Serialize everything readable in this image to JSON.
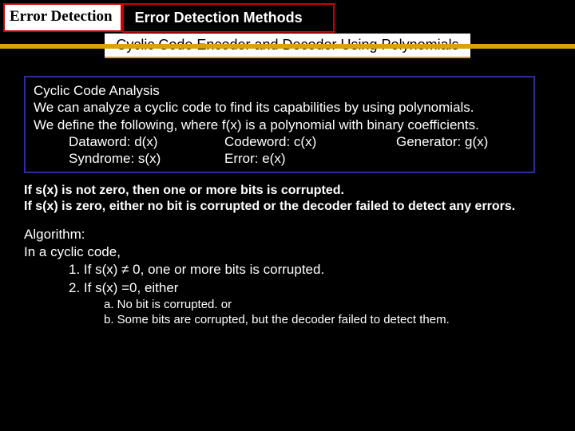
{
  "header": {
    "main": "Error Detection",
    "sub": "Error Detection Methods"
  },
  "section_title": "Cyclic Code Encoder and Decoder Using Polynomials",
  "box": {
    "line1": "Cyclic Code Analysis",
    "line2": "We can analyze a cyclic code to find its capabilities by using polynomials.",
    "line3": "We define the following, where f(x) is a polynomial with binary coefficients.",
    "defs": {
      "r1c1": "Dataword: d(x)",
      "r1c2": "Codeword: c(x)",
      "r1c3": "Generator: g(x)",
      "r2c1": "Syndrome: s(x)",
      "r2c2": "Error: e(x)",
      "r2c3": ""
    }
  },
  "body": {
    "l1": "If s(x) is not zero, then one or more bits is corrupted.",
    "l2": "If s(x) is zero, either no bit is corrupted or the decoder failed to detect any errors."
  },
  "algo": {
    "title": "Algorithm:",
    "intro": "In a cyclic code,",
    "s1": "1. If s(x) ≠ 0, one or more bits is corrupted.",
    "s2": "2. If s(x) =0, either",
    "sa": "a. No bit is corrupted. or",
    "sb": "b. Some bits are corrupted, but the decoder failed to detect them."
  }
}
